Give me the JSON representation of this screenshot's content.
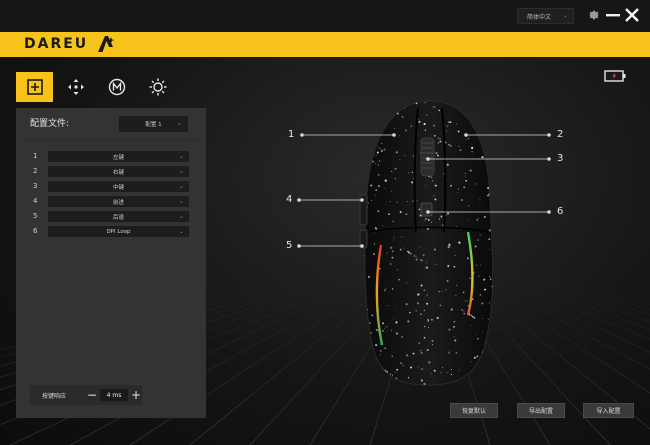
{
  "window": {
    "language": "简体中文"
  },
  "brand": {
    "logo_text": "DAREU"
  },
  "tabs": [
    {
      "icon": "plus-square-icon",
      "active": true
    },
    {
      "icon": "dpi-arrows-icon",
      "active": false
    },
    {
      "icon": "macro-m-icon",
      "active": false
    },
    {
      "icon": "light-sun-icon",
      "active": false
    }
  ],
  "panel": {
    "title": "配置文件:",
    "profile": "配置 1",
    "buttons": [
      {
        "num": "1",
        "value": "左键"
      },
      {
        "num": "2",
        "value": "右键"
      },
      {
        "num": "3",
        "value": "中键"
      },
      {
        "num": "4",
        "value": "前进"
      },
      {
        "num": "5",
        "value": "后退"
      },
      {
        "num": "6",
        "value": "DPI Loop"
      }
    ],
    "response": {
      "label": "按键响应",
      "value": "4 ms",
      "minus": "−",
      "plus": "+"
    }
  },
  "callouts": [
    "1",
    "2",
    "3",
    "4",
    "5",
    "6"
  ],
  "actions": {
    "restore": "恢复默认",
    "export": "导出配置",
    "import": "导入配置"
  },
  "colors": {
    "accent": "#f7c31a",
    "battery_low": "#e0302a"
  }
}
